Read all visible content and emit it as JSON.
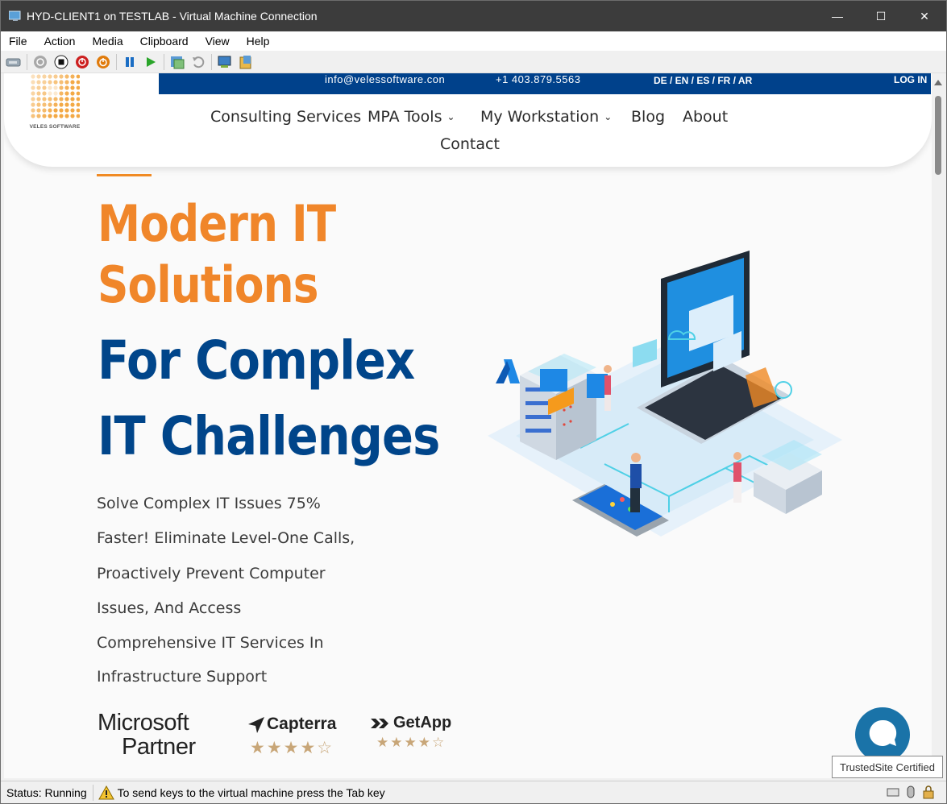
{
  "window": {
    "title": "HYD-CLIENT1 on TESTLAB - Virtual Machine Connection",
    "controls": {
      "minimize": "—",
      "maximize": "☐",
      "close": "✕"
    }
  },
  "menu": [
    "File",
    "Action",
    "Media",
    "Clipboard",
    "View",
    "Help"
  ],
  "toolbar": {
    "icons": [
      "ctrl-alt-del-icon",
      "start-icon",
      "turn-off-icon",
      "shut-down-icon",
      "power-icon",
      "pause-icon",
      "resume-icon",
      "checkpoint-icon",
      "revert-icon",
      "enhanced-session-icon",
      "share-icon"
    ],
    "colors": {
      "off": "#cc1f1f",
      "power": "#e07b0c",
      "pause": "#1a6dc4",
      "resume": "#2aa52a"
    }
  },
  "site": {
    "topbar": {
      "email": "info@velessoftware.con",
      "phone": "+1 403.879.5563",
      "languages": "DE / EN / ES / FR / AR",
      "login": "LOG IN"
    },
    "logo_text": "VELES SOFTWARE",
    "nav": {
      "consulting": "Consulting Services",
      "mpa_tools": "MPA Tools",
      "my_workstation": "My Workstation",
      "blog": "Blog",
      "about": "About",
      "contact": "Contact"
    },
    "hero": {
      "line1": "Modern IT",
      "line2": "Solutions",
      "line3": "For Complex",
      "line4": "IT Challenges",
      "paragraph_lines": [
        "Solve Complex IT Issues 75%",
        "Faster! Eliminate Level-One Calls,",
        "Proactively Prevent Computer",
        "Issues, And Access",
        "Comprehensive IT Services In",
        "Infrastructure Support"
      ]
    },
    "badges": {
      "microsoft_l1": "Microsoft",
      "microsoft_l2": "Partner",
      "capterra": "Capterra",
      "capterra_rating": 4.5,
      "getapp": "GetApp",
      "getapp_rating": 4.5
    },
    "trusted": "TrustedSite Certified",
    "colors": {
      "brand_blue": "#00418b",
      "accent_orange": "#f0862a",
      "hero_blue": "#00458a"
    }
  },
  "status": {
    "state": "Status: Running",
    "hint": "To send keys to the virtual machine press the Tab key"
  }
}
